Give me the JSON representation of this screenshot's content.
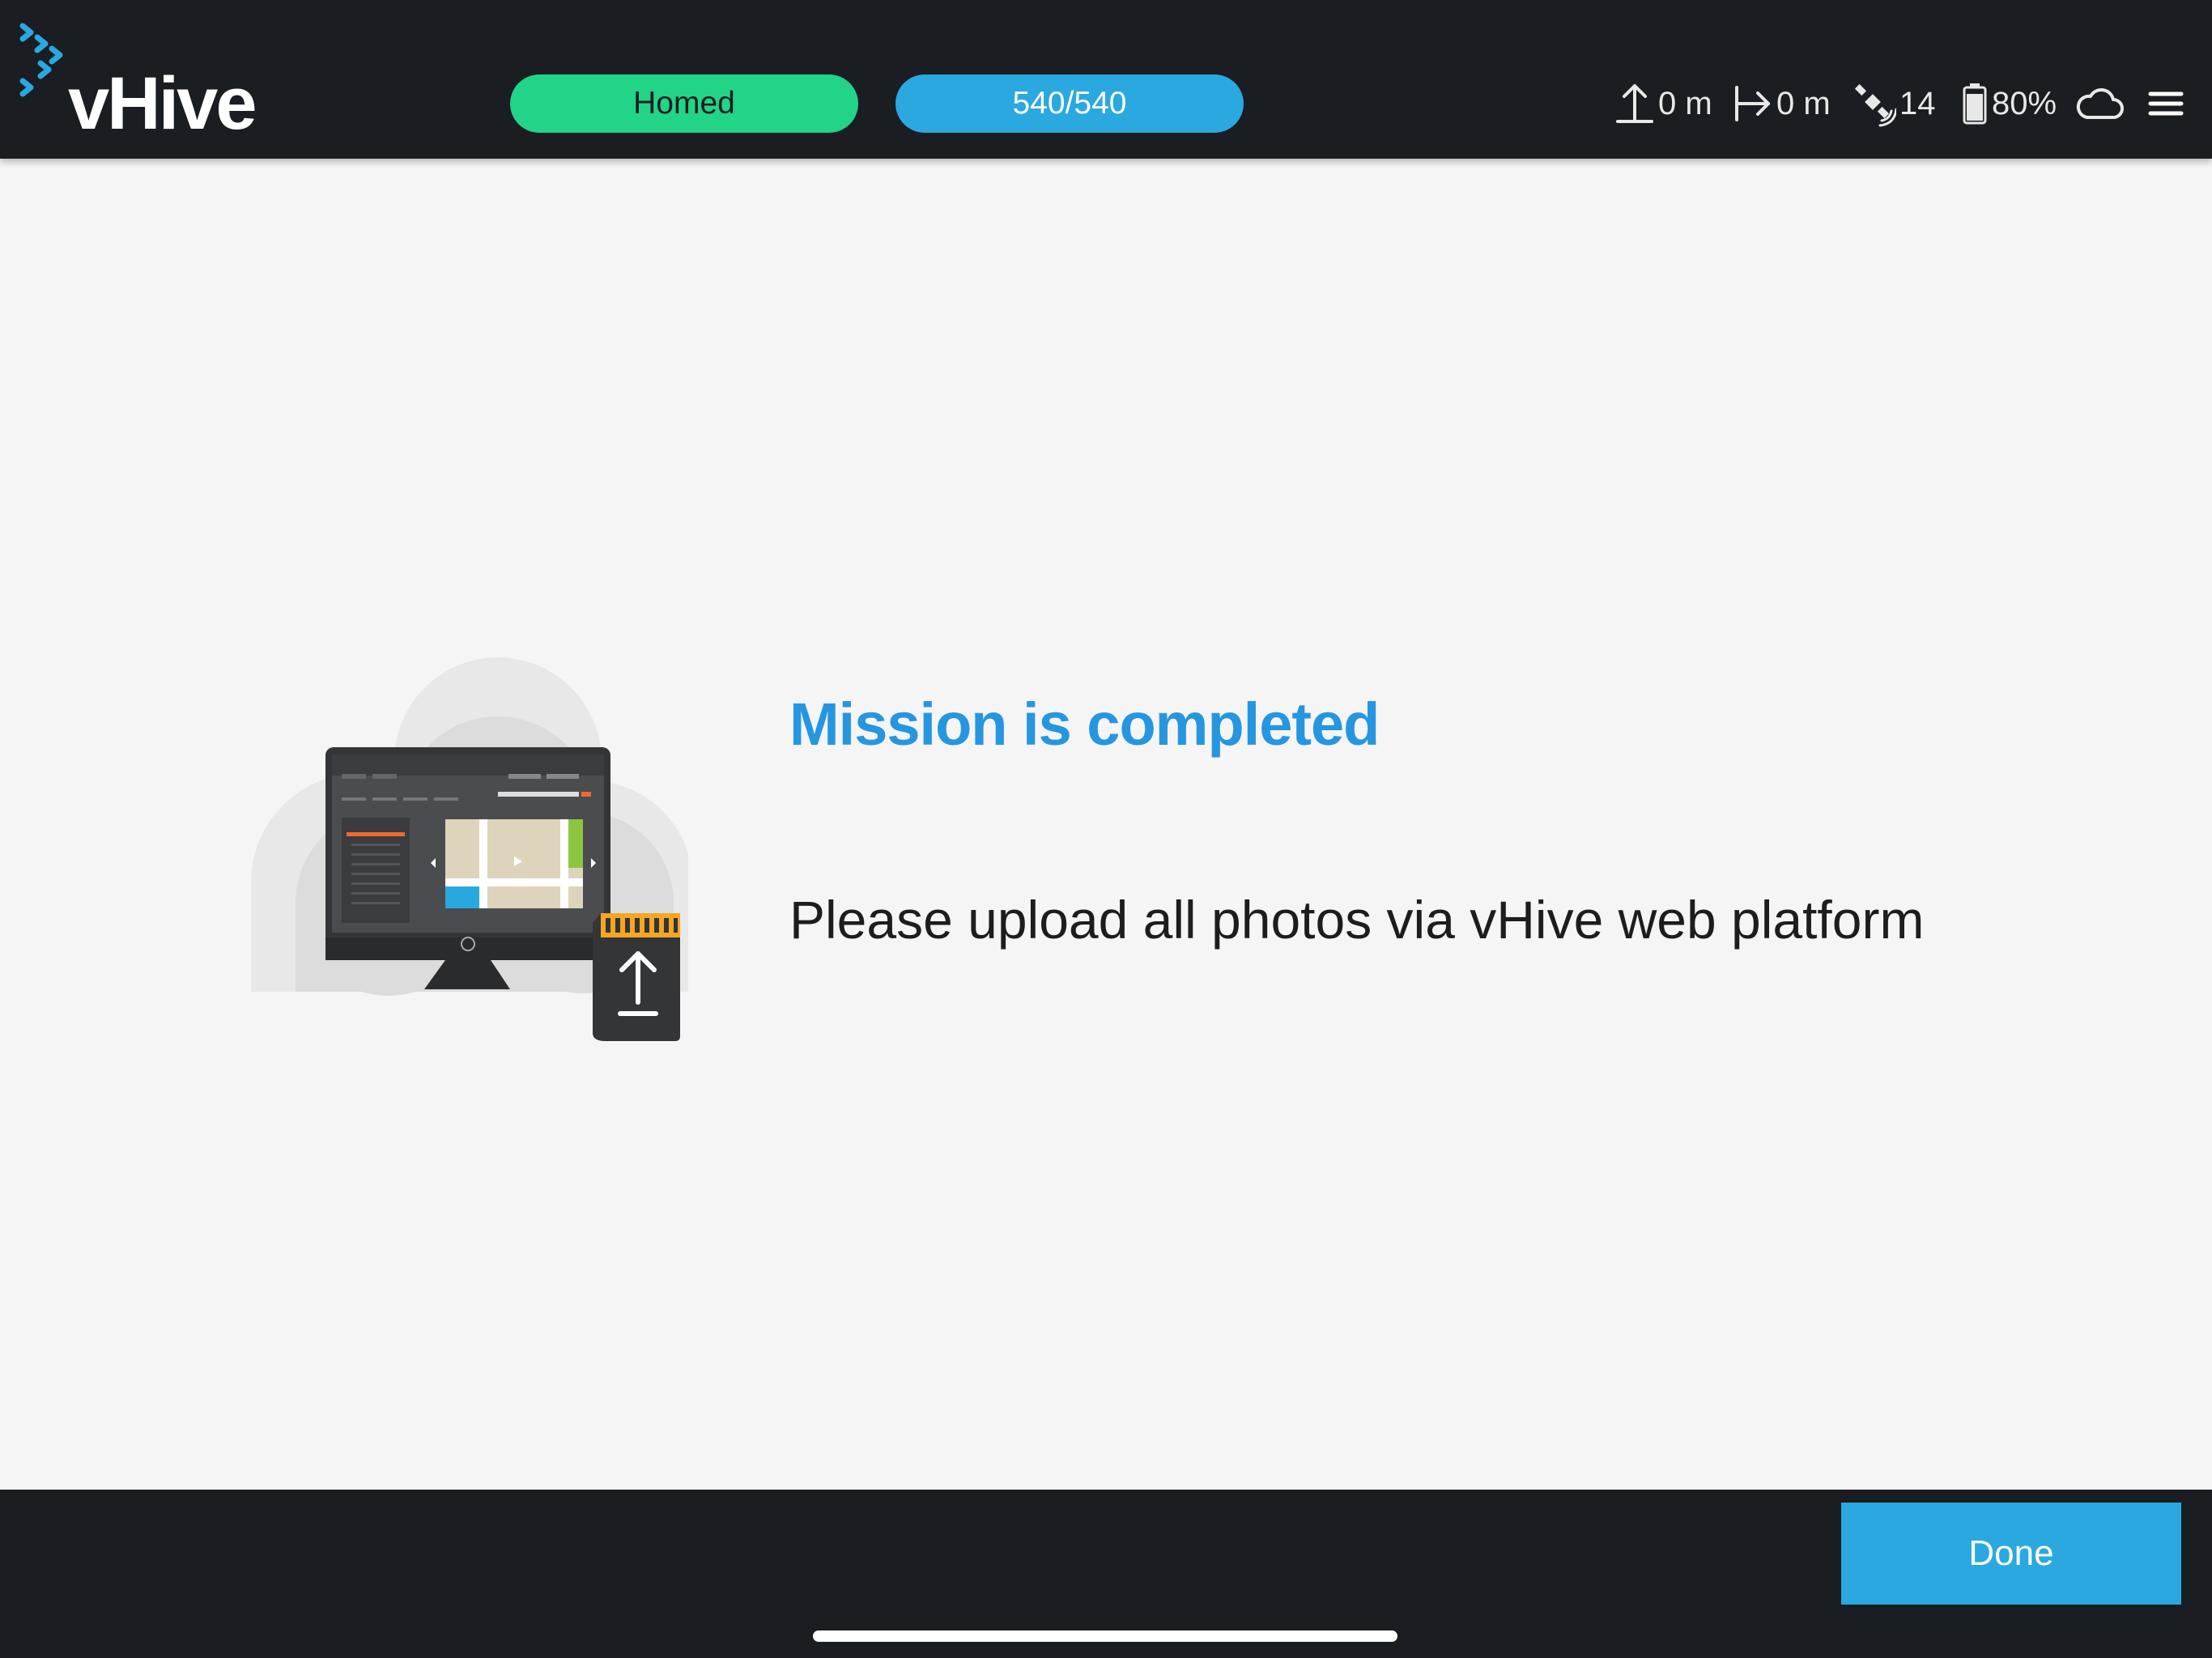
{
  "colors": {
    "topbar_bg": "#1a1d22",
    "accent_blue": "#2aa8e0",
    "status_green": "#22d488",
    "title_blue": "#2696e0",
    "content_bg": "#f5f5f5"
  },
  "header": {
    "logo_text": "vHive",
    "status_pill": "Homed",
    "photos_pill": "540/540",
    "altitude": "0 m",
    "distance": "0 m",
    "satellites": "14",
    "battery": "80%",
    "icons": [
      "altitude-up-icon",
      "distance-icon",
      "satellite-icon",
      "battery-icon",
      "cloud-icon",
      "hamburger-menu-icon"
    ]
  },
  "main": {
    "title": "Mission is completed",
    "message": "Please upload all photos via vHive web platform",
    "illustration": "monitor-with-sd-card-upload"
  },
  "footer": {
    "done_label": "Done"
  }
}
